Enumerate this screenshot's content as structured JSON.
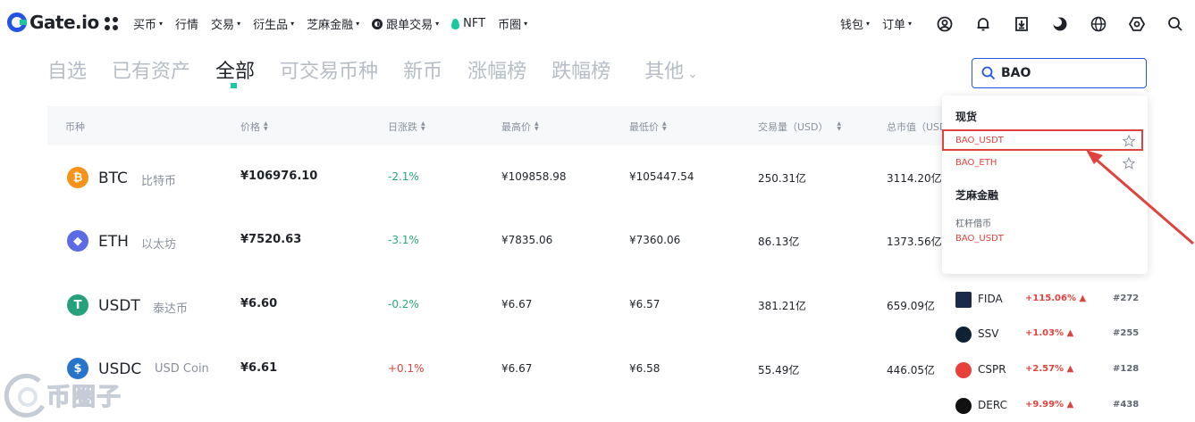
{
  "brand": {
    "logo_text": "Gate.io",
    "accent": "#2354e6",
    "up_color": "#e0433d",
    "down_color": "#28a878"
  },
  "nav": {
    "items": [
      {
        "label": "买币",
        "caret": "▾"
      },
      {
        "label": "行情",
        "caret": ""
      },
      {
        "label": "交易",
        "caret": "▾"
      },
      {
        "label": "衍生品",
        "caret": "▾"
      },
      {
        "label": "芝麻金融",
        "caret": "▾"
      },
      {
        "label": "跟单交易",
        "caret": "▾"
      },
      {
        "label": "NFT",
        "caret": ""
      },
      {
        "label": "币圈",
        "caret": "▾"
      }
    ],
    "right": [
      {
        "label": "钱包",
        "caret": "▾"
      },
      {
        "label": "订单",
        "caret": "▾"
      }
    ],
    "icons": [
      "user-icon",
      "bell-icon",
      "download-icon",
      "theme-icon",
      "globe-icon",
      "settings-icon",
      "search-icon"
    ]
  },
  "tabs": [
    {
      "label": "自选"
    },
    {
      "label": "已有资产"
    },
    {
      "label": "全部"
    },
    {
      "label": "可交易币种"
    },
    {
      "label": "新币"
    },
    {
      "label": "涨幅榜"
    },
    {
      "label": "跌幅榜"
    },
    {
      "label": "其他",
      "caret": "⌄"
    }
  ],
  "search": {
    "value": "BAO"
  },
  "table": {
    "headers": [
      {
        "label": "币种",
        "sortable": false
      },
      {
        "label": "价格",
        "sortable": true
      },
      {
        "label": "日涨跌",
        "sortable": true
      },
      {
        "label": "最高价",
        "sortable": true
      },
      {
        "label": "最低价",
        "sortable": true
      },
      {
        "label": "交易量（USD）",
        "sortable": true
      },
      {
        "label": "总市值（USD",
        "sortable": false
      }
    ],
    "rows": [
      {
        "symbol": "BTC",
        "name": "比特币",
        "price": "¥106976.10",
        "change": "-2.1%",
        "high": "¥109858.98",
        "low": "¥105447.54",
        "volume": "250.31亿",
        "mcap": "3114.20亿",
        "icon_color": "#f7931a",
        "icon_glyph": "₿",
        "direction": "down"
      },
      {
        "symbol": "ETH",
        "name": "以太坊",
        "price": "¥7520.63",
        "change": "-3.1%",
        "high": "¥7835.06",
        "low": "¥7360.06",
        "volume": "86.13亿",
        "mcap": "1373.56亿",
        "icon_color": "#5c6ae6",
        "icon_glyph": "◆",
        "direction": "down"
      },
      {
        "symbol": "USDT",
        "name": "泰达币",
        "price": "¥6.60",
        "change": "-0.2%",
        "high": "¥6.67",
        "low": "¥6.57",
        "volume": "381.21亿",
        "mcap": "659.09亿",
        "icon_color": "#26a17b",
        "icon_glyph": "T",
        "direction": "down"
      },
      {
        "symbol": "USDC",
        "name": "USD Coin",
        "price": "¥6.61",
        "change": "+0.1%",
        "high": "¥6.67",
        "low": "¥6.58",
        "volume": "55.49亿",
        "mcap": "446.05亿",
        "icon_color": "#2775ca",
        "icon_glyph": "$",
        "direction": "up"
      }
    ]
  },
  "dropdown": {
    "spot_header": "现货",
    "spot_items": [
      {
        "label": "BAO_USDT"
      },
      {
        "label": "BAO_ETH"
      }
    ],
    "finance_header": "芝麻金融",
    "finance_sub": "杠杆借币",
    "finance_item": "BAO_USDT"
  },
  "right_list": [
    {
      "symbol": "FIDA",
      "change": "+115.06%",
      "arrow": "▲",
      "rank": "#272",
      "icon_color": "#1c2a4a"
    },
    {
      "symbol": "SSV",
      "change": "+1.03%",
      "arrow": "▲",
      "rank": "#255",
      "icon_color": "#0e2233"
    },
    {
      "symbol": "CSPR",
      "change": "+2.57%",
      "arrow": "▲",
      "rank": "#128",
      "icon_color": "#e8403a"
    },
    {
      "symbol": "DERC",
      "change": "+9.99%",
      "arrow": "▲",
      "rank": "#438",
      "icon_color": "#111111"
    }
  ],
  "watermark": {
    "text": "币圈子"
  }
}
